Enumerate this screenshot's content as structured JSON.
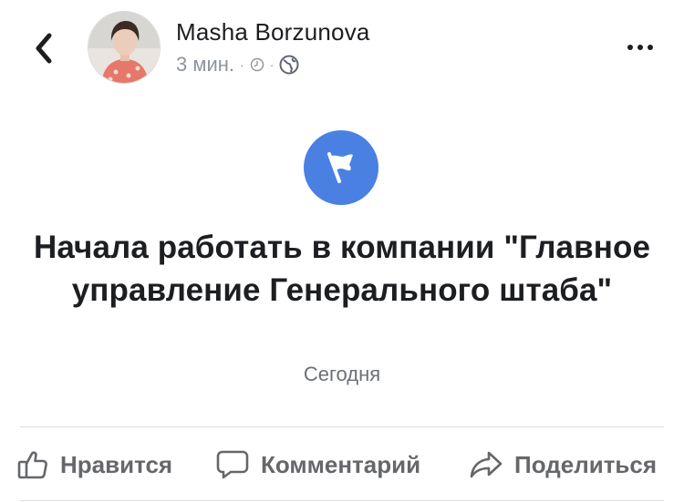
{
  "post": {
    "author_name": "Masha Borzunova",
    "timestamp": "3 мин.",
    "separator": "·"
  },
  "event": {
    "title": "Начала работать в компании \"Главное управление Генерального штаба\"",
    "date": "Сегодня"
  },
  "actions": {
    "like": "Нравится",
    "comment": "Комментарий",
    "share": "Поделиться"
  },
  "colors": {
    "event_icon_bg": "#4a80e2",
    "action_text": "#65676b",
    "meta_text": "#8d949e"
  },
  "icons": [
    "chevron-left-icon",
    "clock-icon",
    "globe-icon",
    "more-icon",
    "flag-icon",
    "thumbs-up-icon",
    "comment-icon",
    "share-icon"
  ]
}
